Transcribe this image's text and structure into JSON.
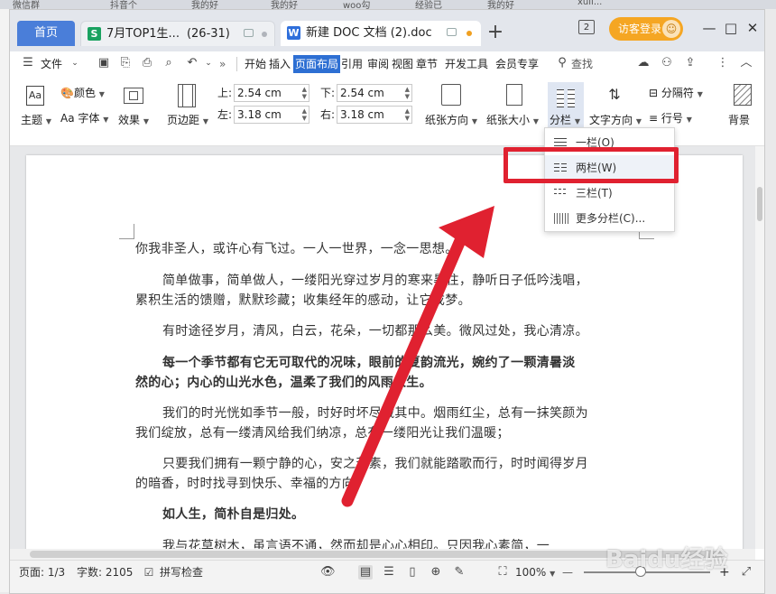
{
  "background_tabs": [
    "微信群",
    "抖音个",
    "我的好",
    "我的好",
    "woo勾",
    "经验已",
    "我的好",
    "xuli..."
  ],
  "tabs": {
    "home": "首页",
    "sheet": {
      "title": "7月TOP1生...",
      "range": "(26-31)",
      "icon": "S",
      "icon_color": "#1aa260"
    },
    "doc": {
      "title": "新建 DOC 文档 (2).doc",
      "icon": "W",
      "icon_color": "#2f6fdb"
    },
    "add": "+"
  },
  "titlebar": {
    "window_count": "2",
    "login_label": "访客登录",
    "avatar": "☺",
    "minimize": "—",
    "maximize": "□",
    "close": "✕"
  },
  "menubar": {
    "file": "文件",
    "more": "»",
    "tabs": [
      "开始",
      "插入",
      "页面布局",
      "引用",
      "审阅",
      "视图",
      "章节",
      "开发工具",
      "会员专享"
    ],
    "search": "查找",
    "active_tab": "页面布局"
  },
  "ribbon": {
    "theme": "主题",
    "color": "颜色",
    "font": "字体",
    "effect": "效果",
    "margins": "页边距",
    "top_label": "上:",
    "bottom_label": "下:",
    "left_label": "左:",
    "right_label": "右:",
    "top": "2.54 cm",
    "bottom": "2.54 cm",
    "left": "3.18 cm",
    "right": "3.18 cm",
    "orientation": "纸张方向",
    "size": "纸张大小",
    "columns": "分栏",
    "text_direction": "文字方向",
    "separator": "分隔符",
    "line_number": "行号",
    "background": "背景"
  },
  "column_menu": {
    "items": [
      "一栏(O)",
      "两栏(W)",
      "三栏(T)",
      "更多分栏(C)..."
    ],
    "highlighted": "两栏(W)"
  },
  "document": {
    "lines": [
      {
        "text": "你我非圣人，或许心有飞过。一人一世界，一念一思想。",
        "bold": false
      },
      {
        "text": "简单做事，简单做人，一缕阳光穿过岁月的寒来暑往，静听日子低吟浅唱，",
        "bold": false
      },
      {
        "text": "累积生活的馈赠，默默珍藏；收集经年的感动，让它成梦。",
        "bold": false
      },
      {
        "text": "有时途径岁月，清风，白云，花朵，一切都那么美。微风过处，我心清凉。",
        "bold": false
      },
      {
        "text": "每一个季节都有它无可取代的况味，眼前的夏韵流光，婉约了一颗清暑淡",
        "bold": true
      },
      {
        "text": "然的心；内心的山光水色，温柔了我们的风雨人生。",
        "bold": true
      },
      {
        "text": "我们的时光恍如季节一般，时好时坏尽藏其中。烟雨红尘，总有一抹笑颜为",
        "bold": false
      },
      {
        "text": "我们绽放，总有一缕清风给我们纳凉，总有一缕阳光让我们温暖；",
        "bold": false
      },
      {
        "text": "只要我们拥有一颗宁静的心，安之若素，我们就能踏歌而行，时时闻得岁月",
        "bold": false
      },
      {
        "text": "的暗香，时时找寻到快乐、幸福的方向。",
        "bold": false
      },
      {
        "text": "如人生，简朴自是归处。",
        "bold": true
      },
      {
        "text": "我与花草树木，虽言语不通，然而却是心心相印。只因我心素简，一",
        "bold": false
      }
    ]
  },
  "statusbar": {
    "page": "页面: 1/3",
    "words": "字数: 2105",
    "spellcheck": "拼写检查",
    "zoom": "100%",
    "zoom_level": 0.45,
    "zoom_out": "—",
    "zoom_in": "+"
  },
  "watermark": "Baidu经验",
  "colors": {
    "accent": "#2d6fd3",
    "annotation": "#e02130",
    "login": "#f5a623"
  }
}
